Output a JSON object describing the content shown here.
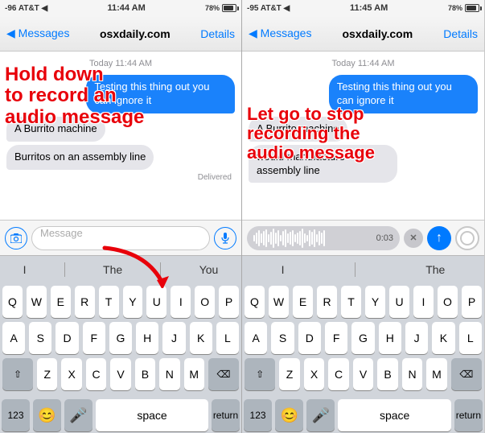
{
  "phone1": {
    "status": {
      "left": "-96 AT&T ◀",
      "time": "11:44 AM",
      "right": "78%"
    },
    "nav": {
      "back": "◀ Messages",
      "title": "osxdaily.com",
      "detail": "Details"
    },
    "date_label": "Today 11:44 AM",
    "bubbles": [
      {
        "type": "sent",
        "text": "Testing this thing out you can ignore it"
      },
      {
        "type": "received",
        "text": "A Burrito machine"
      },
      {
        "type": "received",
        "text": "Burritos on an assembly line"
      }
    ],
    "delivered": "Delivered",
    "input_placeholder": "Message",
    "autocorrect": [
      "I",
      "The",
      "You"
    ],
    "overlay_title": "Hold down\nto record an\naudio message",
    "keyboard_rows": [
      [
        "Q",
        "W",
        "E",
        "R",
        "T",
        "Y",
        "U",
        "I",
        "O",
        "P"
      ],
      [
        "A",
        "S",
        "D",
        "F",
        "G",
        "H",
        "J",
        "K",
        "L"
      ],
      [
        "⇧",
        "Z",
        "X",
        "C",
        "V",
        "B",
        "N",
        "M",
        "⌫"
      ],
      [
        "123",
        "😊",
        "🎤",
        "space",
        "return"
      ]
    ]
  },
  "phone2": {
    "status": {
      "left": "-95 AT&T ◀",
      "time": "11:45 AM",
      "right": "78%"
    },
    "nav": {
      "back": "◀ Messages",
      "title": "osxdaily.com",
      "detail": "Details"
    },
    "date_label": "Today 11:44 AM",
    "bubbles": [
      {
        "type": "sent",
        "text": "Testing this thing out you can ignore it"
      },
      {
        "type": "received",
        "text": "A Burrito machine"
      },
      {
        "type": "received",
        "text": "would manufacture assembly line"
      }
    ],
    "timer": "0:03",
    "autocorrect": [
      "I",
      "The"
    ],
    "overlay_title": "Let go to stop\nrecording the\naudio message",
    "keyboard_rows": [
      [
        "Q",
        "W",
        "E",
        "R",
        "T",
        "Y",
        "U",
        "I",
        "O",
        "P"
      ],
      [
        "A",
        "S",
        "D",
        "F",
        "G",
        "H",
        "J",
        "K",
        "L"
      ],
      [
        "⇧",
        "Z",
        "X",
        "C",
        "V",
        "B",
        "N",
        "M",
        "⌫"
      ],
      [
        "123",
        "😊",
        "🎤",
        "space",
        "return"
      ]
    ]
  }
}
